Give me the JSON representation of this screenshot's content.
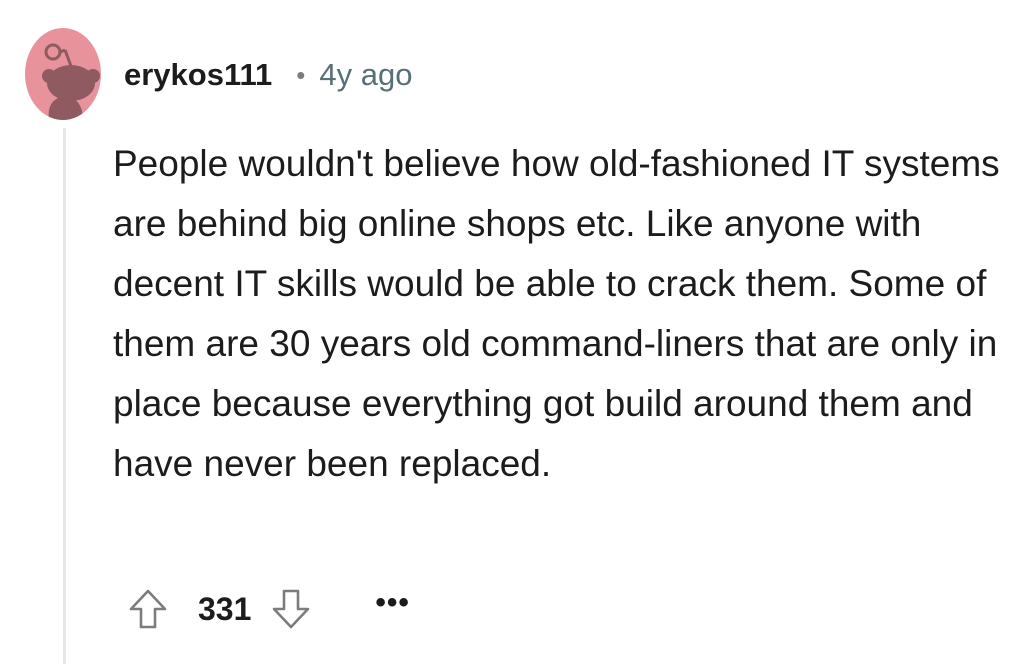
{
  "comment": {
    "author": "erykos111",
    "separator": "•",
    "timestamp": "4y ago",
    "body": "People wouldn't believe how old-fashioned IT systems are behind big online shops etc. Like anyone with decent IT skills would be able to crack them. Some of them are 30 years old command-liners that are only in place because everything got build around them and have never been replaced.",
    "score": "331",
    "more_label": "•••"
  },
  "icons": {
    "avatar": "reddit-snoo-avatar",
    "upvote": "arrow-up-outline-icon",
    "downvote": "arrow-down-outline-icon"
  },
  "colors": {
    "avatar_bg": "#e8939b",
    "avatar_fg": "#8f5a60",
    "thread_line": "#e5e8ea",
    "text": "#1c1c1c",
    "meta": "#576f76"
  }
}
